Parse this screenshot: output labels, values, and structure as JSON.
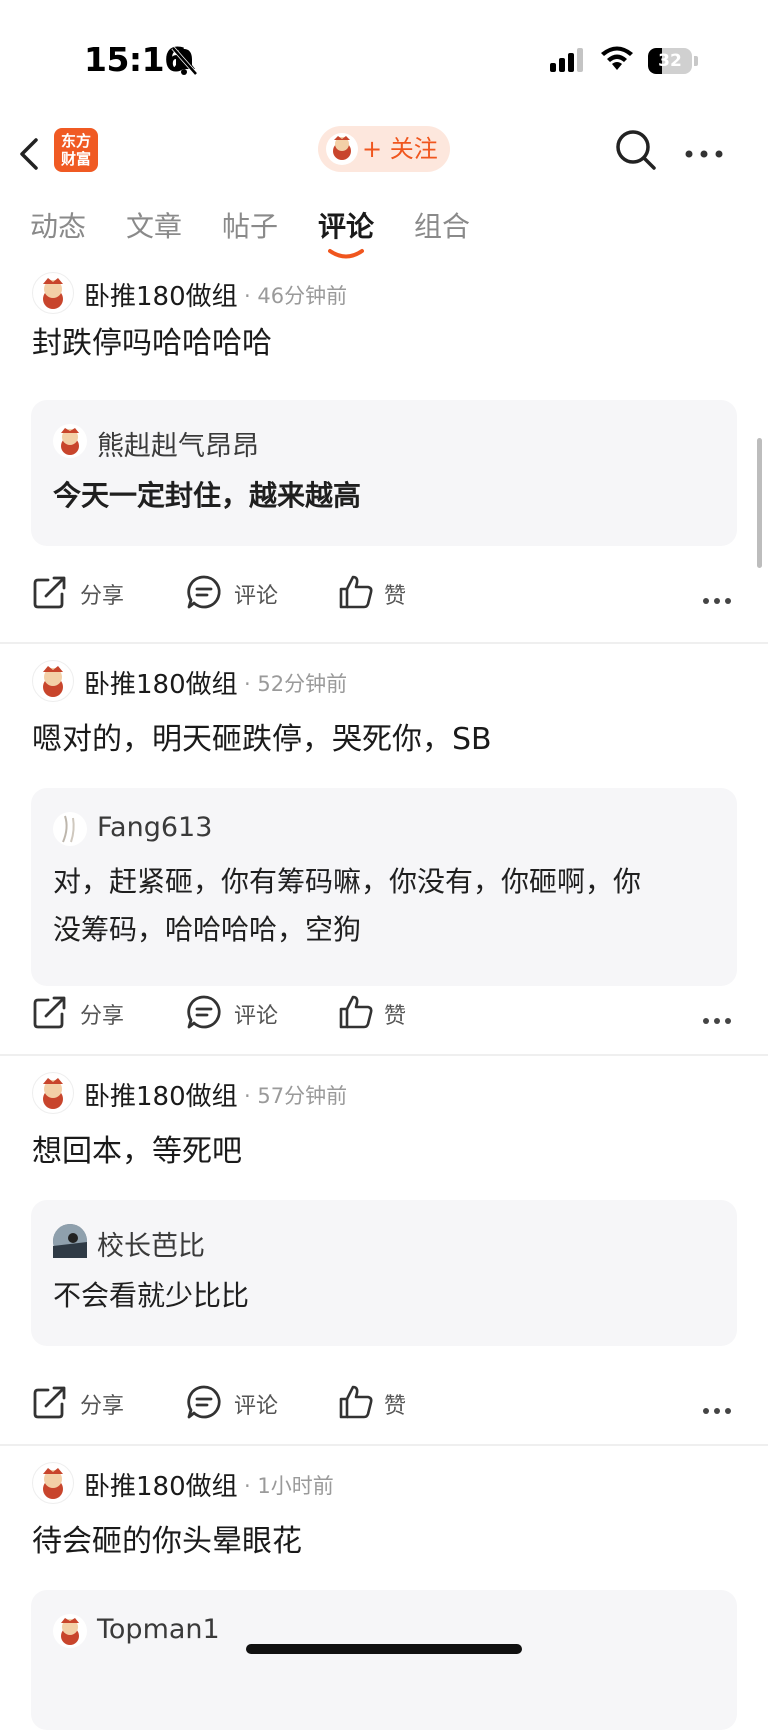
{
  "status": {
    "time": "15:16",
    "battery": "32",
    "battery_level": 0.32
  },
  "nav": {
    "logo_line1": "东方",
    "logo_line2": "财富",
    "follow_label": "+ 关注"
  },
  "tabs": [
    {
      "label": "动态",
      "active": false
    },
    {
      "label": "文章",
      "active": false
    },
    {
      "label": "帖子",
      "active": false
    },
    {
      "label": "评论",
      "active": true
    },
    {
      "label": "组合",
      "active": false
    }
  ],
  "actions": {
    "share": "分享",
    "comment": "评论",
    "like": "赞"
  },
  "posts": [
    {
      "author": "卧推180做组",
      "time": "· 46分钟前",
      "text": "封跌停吗哈哈哈哈",
      "quote_user": "熊赳赳气昂昂",
      "quote_lines": [
        "今天一定封住，越来越高"
      ]
    },
    {
      "author": "卧推180做组",
      "time": "· 52分钟前",
      "text": "嗯对的，明天砸跌停，哭死你，SB",
      "quote_user": "Fang613",
      "quote_lines": [
        "对，赶紧砸，你有筹码嘛，你没有，你砸啊，你",
        "没筹码，哈哈哈哈，空狗"
      ]
    },
    {
      "author": "卧推180做组",
      "time": "· 57分钟前",
      "text": "想回本，等死吧",
      "quote_user": "校长芭比",
      "quote_lines": [
        "不会看就少比比"
      ]
    },
    {
      "author": "卧推180做组",
      "time": "· 1小时前",
      "text": "待会砸的你头晕眼花",
      "quote_user": "Topman1"
    }
  ],
  "colors": {
    "accent": "#f0561e",
    "follow_bg": "#fde7dd",
    "quote_bg": "#f6f6f8"
  }
}
